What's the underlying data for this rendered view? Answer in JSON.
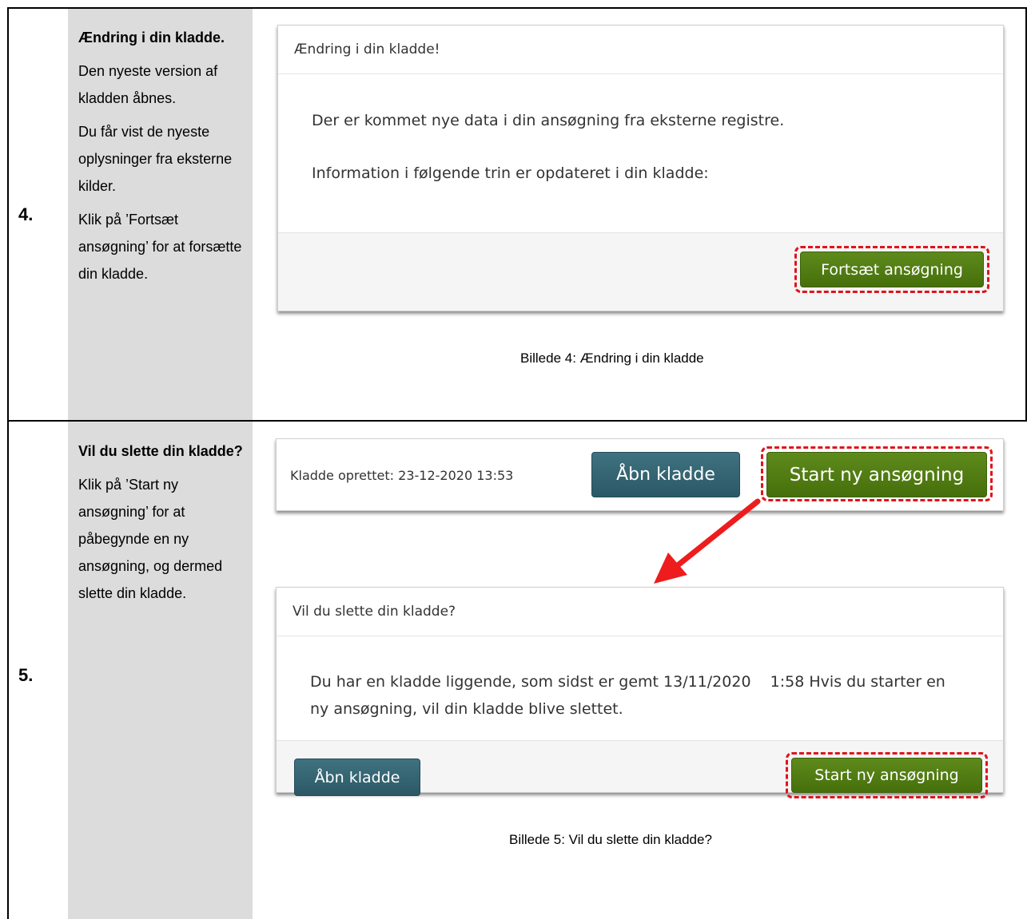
{
  "row4": {
    "number": "4.",
    "title": "Ændring i din kladde.",
    "paragraphs": [
      "Den nyeste version af kladden åbnes.",
      "Du får vist de nyeste oplysninger fra eksterne kilder.",
      "Klik på ’Fortsæt ansøgning’ for at forsætte din kladde."
    ],
    "dialog": {
      "header": "Ændring i din kladde!",
      "line1": "Der er kommet nye data i din ansøgning fra eksterne registre.",
      "line2": "Information i følgende trin er opdateret i din kladde:",
      "button": "Fortsæt ansøgning"
    },
    "caption": "Billede 4: Ændring i din kladde"
  },
  "row5": {
    "number": "5.",
    "title": "Vil du slette din kladde?",
    "paragraph": "Klik på ’Start ny ansøgning’ for at påbegynde en ny ansøgning, og dermed slette din kladde.",
    "bar": {
      "created_label": "Kladde oprettet: 23-12-2020 13:53",
      "open_button": "Åbn kladde",
      "new_button": "Start ny ansøgning"
    },
    "dialog": {
      "header": "Vil du slette din kladde?",
      "body": "Du har en kladde liggende, som sidst er gemt 13/11/2020    1:58 Hvis du starter en ny ansøgning, vil din kladde blive slettet.",
      "open_button": "Åbn kladde",
      "new_button": "Start ny ansøgning"
    },
    "caption": "Billede 5: Vil du slette din kladde?"
  },
  "colors": {
    "green_button": "#4f7a12",
    "teal_button": "#336473",
    "highlight": "#e0141a",
    "arrow": "#ee1c1c",
    "gray_column": "#dcdcdc"
  }
}
